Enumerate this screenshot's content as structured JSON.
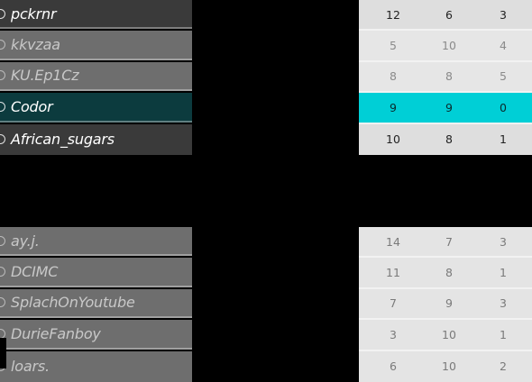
{
  "scoreboard": {
    "team_a": [
      {
        "name": "pckrnr",
        "stats": [
          "12",
          "6",
          "3"
        ],
        "style": "dark",
        "stat_style": "normal"
      },
      {
        "name": "kkvzaa",
        "stats": [
          "5",
          "10",
          "4"
        ],
        "style": "grey",
        "stat_style": "light"
      },
      {
        "name": "KU.Ep1Cz",
        "stats": [
          "8",
          "8",
          "5"
        ],
        "style": "grey",
        "stat_style": "light"
      },
      {
        "name": "Codor",
        "stats": [
          "9",
          "9",
          "0"
        ],
        "style": "hl",
        "stat_style": "hl"
      },
      {
        "name": "African_sugars",
        "stats": [
          "10",
          "8",
          "1"
        ],
        "style": "dark",
        "stat_style": "normal"
      }
    ],
    "team_b": [
      {
        "name": "ay.j.",
        "stats": [
          "14",
          "7",
          "3"
        ],
        "style": "grey",
        "stat_style": "dimrow"
      },
      {
        "name": "DCIMC",
        "stats": [
          "11",
          "8",
          "1"
        ],
        "style": "grey",
        "stat_style": "dimrow"
      },
      {
        "name": "SplachOnYoutube",
        "stats": [
          "7",
          "9",
          "3"
        ],
        "style": "grey",
        "stat_style": "dimrow"
      },
      {
        "name": "DurieFanboy",
        "stats": [
          "3",
          "10",
          "1"
        ],
        "style": "grey",
        "stat_style": "dimrow"
      },
      {
        "name": "loars.",
        "stats": [
          "6",
          "10",
          "2"
        ],
        "style": "grey",
        "stat_style": "dimrow"
      }
    ]
  },
  "colors": {
    "highlight_name_bg": "#0c3b3e",
    "highlight_stats_bg": "#00cfd6",
    "dark_row_bg": "#3a3a3a",
    "grey_row_bg": "#6e6e6e"
  }
}
